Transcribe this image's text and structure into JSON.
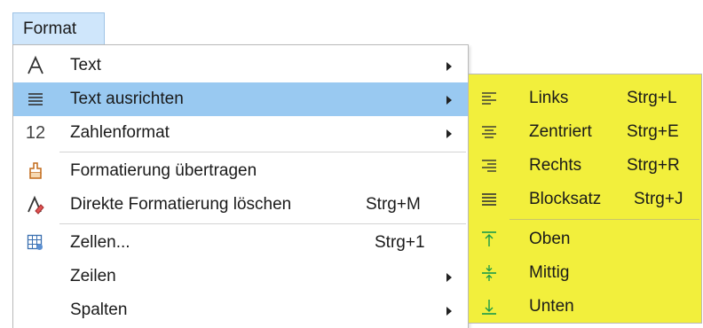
{
  "menubar": {
    "title": "Format"
  },
  "menu": {
    "items": [
      {
        "label": "Text",
        "shortcut": "",
        "submenu": true,
        "icon": "text-a-icon",
        "highlighted": false
      },
      {
        "label": "Text ausrichten",
        "shortcut": "",
        "submenu": true,
        "icon": "align-icon",
        "highlighted": true
      },
      {
        "label": "Zahlenformat",
        "shortcut": "",
        "submenu": true,
        "icon": "number-format-icon",
        "highlighted": false
      },
      {
        "label": "Formatierung übertragen",
        "shortcut": "",
        "submenu": false,
        "icon": "paintbrush-icon",
        "highlighted": false
      },
      {
        "label": "Direkte Formatierung löschen",
        "shortcut": "Strg+M",
        "submenu": false,
        "icon": "clear-formatting-icon",
        "highlighted": false
      },
      {
        "label": "Zellen...",
        "shortcut": "Strg+1",
        "submenu": false,
        "icon": "cells-icon",
        "highlighted": false
      },
      {
        "label": "Zeilen",
        "shortcut": "",
        "submenu": true,
        "icon": "",
        "highlighted": false
      },
      {
        "label": "Spalten",
        "shortcut": "",
        "submenu": true,
        "icon": "",
        "highlighted": false
      }
    ]
  },
  "submenu": {
    "background": "#f2ef3c",
    "items": [
      {
        "label": "Links",
        "shortcut": "Strg+L",
        "icon": "align-left-icon"
      },
      {
        "label": "Zentriert",
        "shortcut": "Strg+E",
        "icon": "align-center-icon"
      },
      {
        "label": "Rechts",
        "shortcut": "Strg+R",
        "icon": "align-right-icon"
      },
      {
        "label": "Blocksatz",
        "shortcut": "Strg+J",
        "icon": "align-justify-icon"
      },
      {
        "label": "Oben",
        "shortcut": "",
        "icon": "align-top-icon"
      },
      {
        "label": "Mittig",
        "shortcut": "",
        "icon": "align-middle-icon"
      },
      {
        "label": "Unten",
        "shortcut": "",
        "icon": "align-bottom-icon"
      }
    ]
  },
  "colors": {
    "highlight": "#99c9f1",
    "menubar_active": "#cfe6fb",
    "submenu_bg": "#f2ef3c"
  }
}
